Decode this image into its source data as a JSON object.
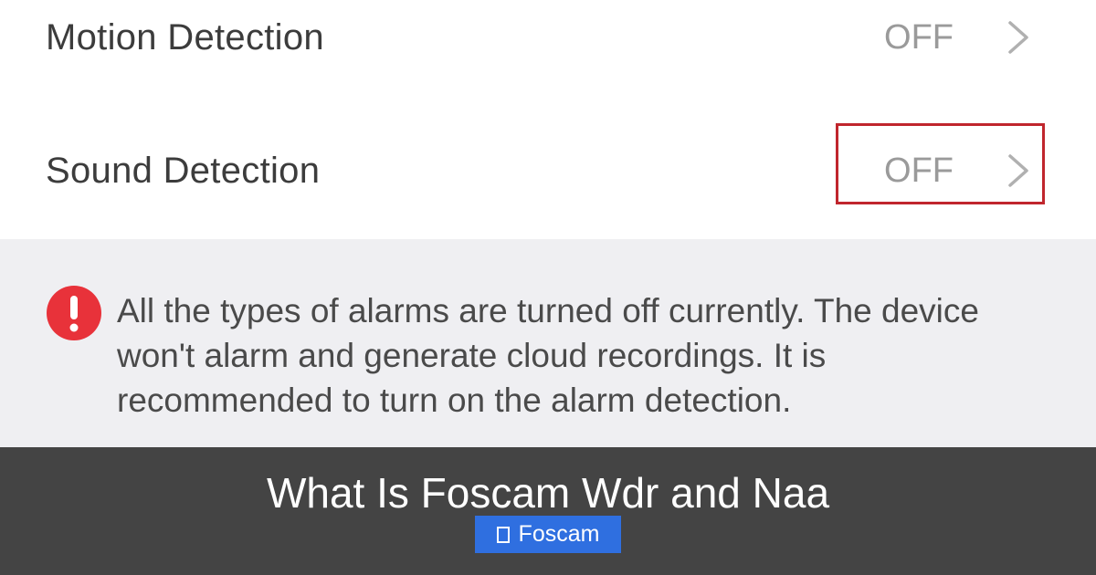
{
  "settings": {
    "motion_detection": {
      "label": "Motion Detection",
      "value": "OFF",
      "icon": "chevron-right-icon"
    },
    "sound_detection": {
      "label": "Sound Detection",
      "value": "OFF",
      "icon": "chevron-right-icon",
      "highlighted": true
    }
  },
  "notice": {
    "icon": "exclamation-circle-icon",
    "text": "All the types of alarms are turned off currently. The device won't alarm and generate cloud recordings. It is recommended to turn on the alarm detection."
  },
  "banner": {
    "title": "What Is Foscam Wdr and Naa",
    "tag": {
      "label": "Foscam",
      "icon": "tag-icon"
    }
  },
  "colors": {
    "highlight_border": "#c0262d",
    "alert_red": "#e8323a",
    "notice_background": "#efeff2",
    "banner_background": "#444444",
    "tag_background": "#2f6fe0"
  }
}
